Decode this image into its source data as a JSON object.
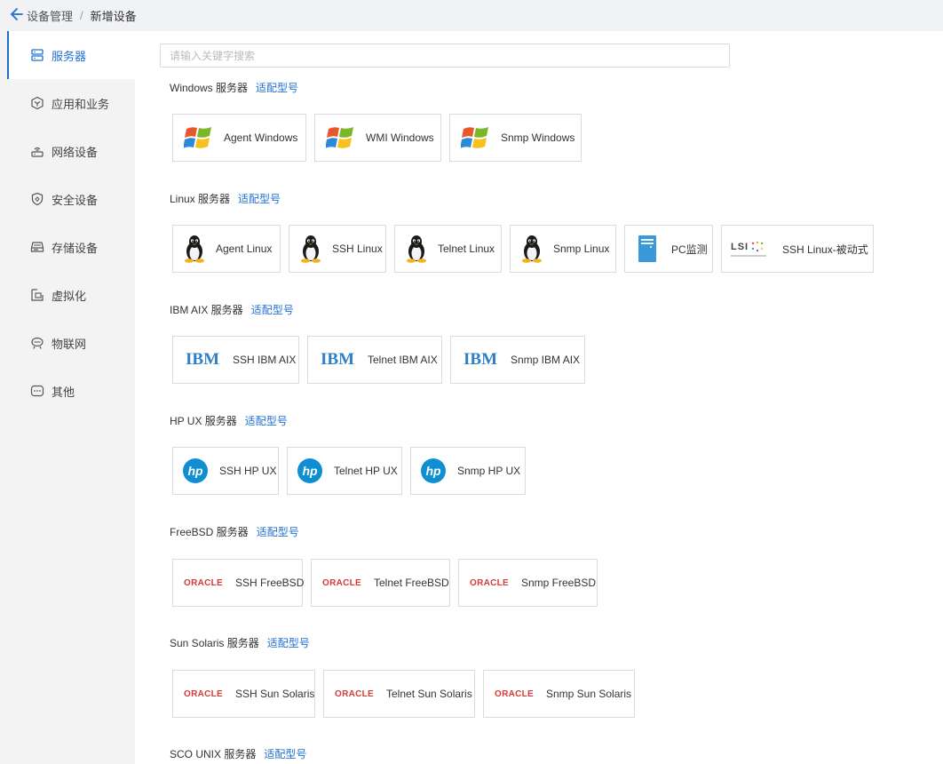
{
  "breadcrumb": {
    "parent": "设备管理",
    "separator": "/",
    "current": "新增设备"
  },
  "search": {
    "placeholder": "请输入关键字搜索",
    "value": ""
  },
  "sidebar": {
    "items": [
      {
        "label": "服务器",
        "icon": "server-icon",
        "active": true
      },
      {
        "label": "应用和业务",
        "icon": "cube-icon",
        "active": false
      },
      {
        "label": "网络设备",
        "icon": "router-icon",
        "active": false
      },
      {
        "label": "安全设备",
        "icon": "shield-icon",
        "active": false
      },
      {
        "label": "存储设备",
        "icon": "storage-icon",
        "active": false
      },
      {
        "label": "虚拟化",
        "icon": "virtualization-icon",
        "active": false
      },
      {
        "label": "物联网",
        "icon": "iot-icon",
        "active": false
      },
      {
        "label": "其他",
        "icon": "more-icon",
        "active": false
      }
    ]
  },
  "link_label": "适配型号",
  "sections": [
    {
      "title": "Windows 服务器",
      "cards": [
        {
          "label": "Agent Windows",
          "logo": "windows-logo"
        },
        {
          "label": "WMI Windows",
          "logo": "windows-logo"
        },
        {
          "label": "Snmp Windows",
          "logo": "windows-logo"
        }
      ]
    },
    {
      "title": "Linux 服务器",
      "cards": [
        {
          "label": "Agent Linux",
          "logo": "tux-logo"
        },
        {
          "label": "SSH Linux",
          "logo": "tux-logo"
        },
        {
          "label": "Telnet Linux",
          "logo": "tux-logo"
        },
        {
          "label": "Snmp Linux",
          "logo": "tux-logo"
        },
        {
          "label": "PC监测",
          "logo": "pc-tower-logo"
        },
        {
          "label": "SSH Linux-被动式",
          "logo": "lsi-logo",
          "logo_text": "LSI"
        }
      ]
    },
    {
      "title": "IBM AIX 服务器",
      "cards": [
        {
          "label": "SSH IBM AIX",
          "logo": "ibm-logo",
          "logo_text": "IBM"
        },
        {
          "label": "Telnet IBM AIX",
          "logo": "ibm-logo",
          "logo_text": "IBM"
        },
        {
          "label": "Snmp IBM AIX",
          "logo": "ibm-logo",
          "logo_text": "IBM"
        }
      ]
    },
    {
      "title": "HP UX 服务器",
      "cards": [
        {
          "label": "SSH HP UX",
          "logo": "hp-logo"
        },
        {
          "label": "Telnet HP UX",
          "logo": "hp-logo"
        },
        {
          "label": "Snmp HP UX",
          "logo": "hp-logo"
        }
      ]
    },
    {
      "title": "FreeBSD 服务器",
      "cards": [
        {
          "label": "SSH FreeBSD",
          "logo": "oracle-logo",
          "logo_text": "ORACLE"
        },
        {
          "label": "Telnet FreeBSD",
          "logo": "oracle-logo",
          "logo_text": "ORACLE"
        },
        {
          "label": "Snmp FreeBSD",
          "logo": "oracle-logo",
          "logo_text": "ORACLE"
        }
      ]
    },
    {
      "title": "Sun Solaris 服务器",
      "cards": [
        {
          "label": "SSH Sun Solaris",
          "logo": "oracle-logo",
          "logo_text": "ORACLE"
        },
        {
          "label": "Telnet Sun Solaris",
          "logo": "oracle-logo",
          "logo_text": "ORACLE"
        },
        {
          "label": "Snmp Sun Solaris",
          "logo": "oracle-logo",
          "logo_text": "ORACLE"
        }
      ]
    },
    {
      "title": "SCO UNIX 服务器",
      "cards": []
    }
  ],
  "colors": {
    "accent": "#1f6fd1",
    "oracle_red": "#d63a3a",
    "ibm_blue": "#2f7fc8",
    "hp_blue": "#0f8fd2",
    "sidebar_bg": "#f3f3f3",
    "topbar_bg": "#f0f2f5"
  }
}
